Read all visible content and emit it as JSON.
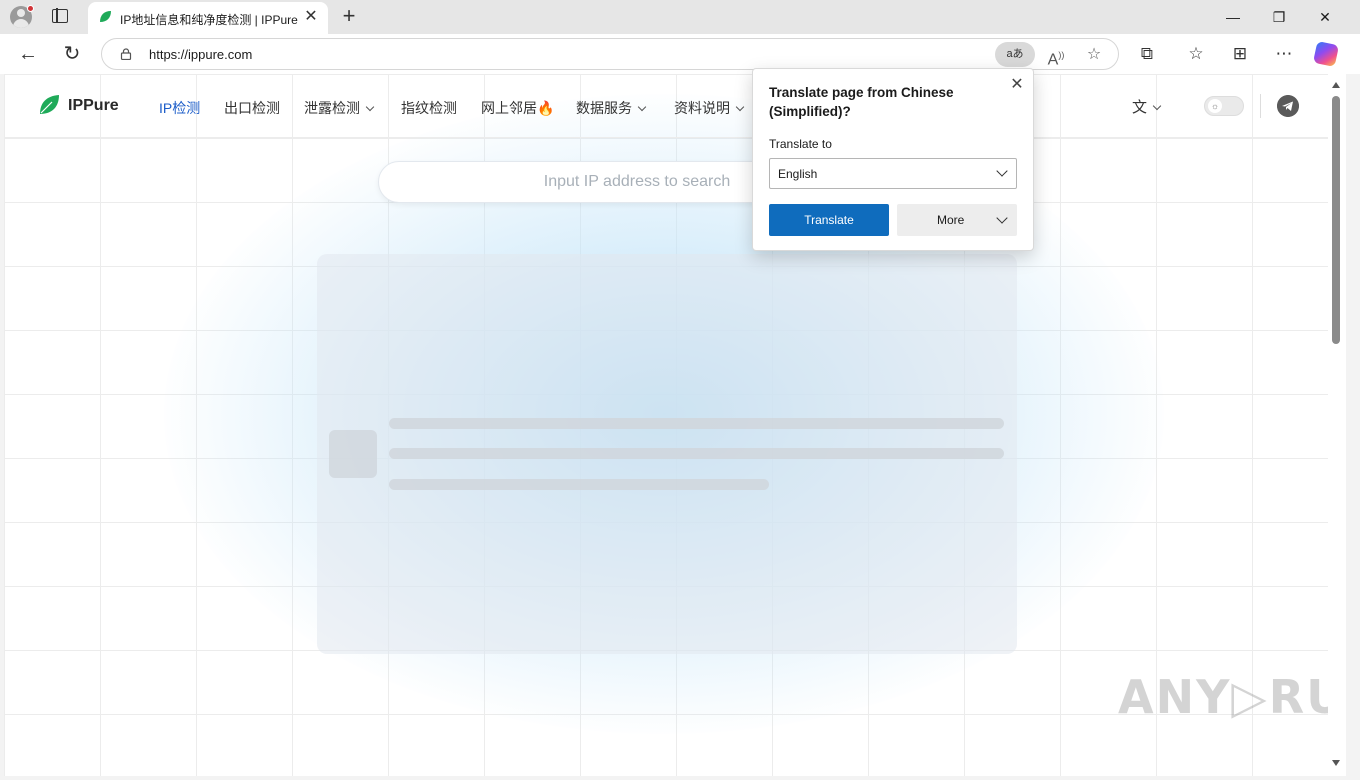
{
  "browser": {
    "tab": {
      "title": "IP地址信息和纯净度检测 | IPPure",
      "close": "✕"
    },
    "new_tab": "+",
    "window": {
      "minimize": "—",
      "restore": "❐",
      "close": "✕"
    },
    "address": {
      "url": "https://ippure.com",
      "translate_pill": "aあ"
    },
    "icons": [
      "back-icon",
      "refresh-icon",
      "lock-icon",
      "read-aloud-icon",
      "favorite-star-icon",
      "extensions-icon",
      "favorites-icon",
      "collections-icon",
      "more-icon",
      "copilot-icon"
    ]
  },
  "site": {
    "logo_text": "IPPure",
    "nav": [
      {
        "label": "IP检测",
        "active": true
      },
      {
        "label": "出口检测"
      },
      {
        "label": "泄露检测",
        "dropdown": true
      },
      {
        "label": "指纹检测"
      },
      {
        "label": "网上邻居",
        "badge": "🔥"
      },
      {
        "label": "数据服务",
        "dropdown": true
      },
      {
        "label": "资料说明",
        "dropdown": true
      }
    ],
    "search_placeholder": "Input IP address to search",
    "accent_color": "#1c5dc9",
    "logo_color": "#1faa59"
  },
  "translate_popup": {
    "title": "Translate page from Chinese (Simplified)?",
    "translate_to_label": "Translate to",
    "selected_language": "English",
    "translate_button": "Translate",
    "more_button": "More",
    "close": "✕",
    "button_color": "#0f6cbd"
  },
  "watermark": "ANY▷RUN"
}
